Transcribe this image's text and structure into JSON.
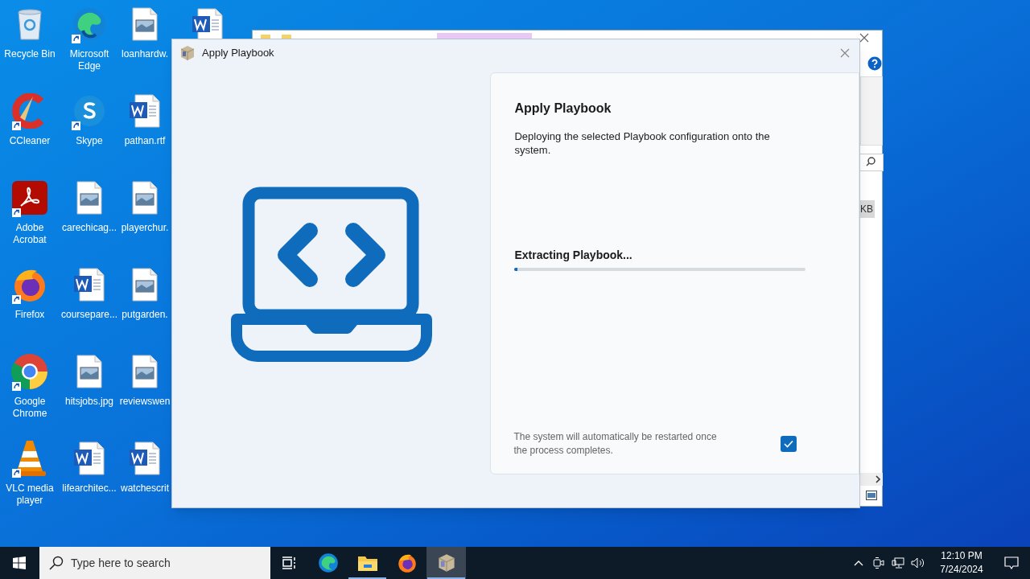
{
  "desktop_icons": [
    {
      "label": "Recycle Bin",
      "kind": "recycle",
      "shortcut": false
    },
    {
      "label": "Microsoft Edge",
      "kind": "edge",
      "shortcut": true
    },
    {
      "label": "loanhardw.",
      "kind": "image",
      "shortcut": false
    },
    {
      "label": "CCleaner",
      "kind": "ccleaner",
      "shortcut": true
    },
    {
      "label": "Skype",
      "kind": "skype",
      "shortcut": true
    },
    {
      "label": "pathan.rtf",
      "kind": "word",
      "shortcut": false
    },
    {
      "label": "Adobe Acrobat",
      "kind": "acrobat",
      "shortcut": true
    },
    {
      "label": "carechicag...",
      "kind": "image",
      "shortcut": false
    },
    {
      "label": "playerchur.",
      "kind": "image",
      "shortcut": false
    },
    {
      "label": "Firefox",
      "kind": "firefox",
      "shortcut": true
    },
    {
      "label": "coursepare...",
      "kind": "word",
      "shortcut": false
    },
    {
      "label": "putgarden.",
      "kind": "image",
      "shortcut": false
    },
    {
      "label": "Google Chrome",
      "kind": "chrome",
      "shortcut": true
    },
    {
      "label": "hitsjobs.jpg",
      "kind": "image",
      "shortcut": false
    },
    {
      "label": "reviewswen",
      "kind": "image",
      "shortcut": false
    },
    {
      "label": "VLC media player",
      "kind": "vlc",
      "shortcut": true
    },
    {
      "label": "lifearchitec...",
      "kind": "word",
      "shortcut": false
    },
    {
      "label": "watchescrit",
      "kind": "word",
      "shortcut": false
    }
  ],
  "background_window": {
    "size_fragment": "KB"
  },
  "dialog": {
    "title": "Apply Playbook",
    "card": {
      "heading": "Apply Playbook",
      "description": "Deploying the selected Playbook configuration onto the system.",
      "status": "Extracting Playbook...",
      "progress": {
        "level": 0.01
      },
      "note": "The system will automatically be restarted once the process completes.",
      "restart_checkbox": {
        "checked": true
      }
    }
  },
  "taskbar": {
    "search_placeholder": "Type here to search",
    "apps": [
      {
        "kind": "edge",
        "selected": false,
        "running": false
      },
      {
        "kind": "explorer",
        "selected": false,
        "running": true
      },
      {
        "kind": "firefox",
        "selected": false,
        "running": false
      },
      {
        "kind": "package",
        "selected": true,
        "running": true
      }
    ],
    "time": "12:10 PM",
    "date": "7/24/2024"
  }
}
